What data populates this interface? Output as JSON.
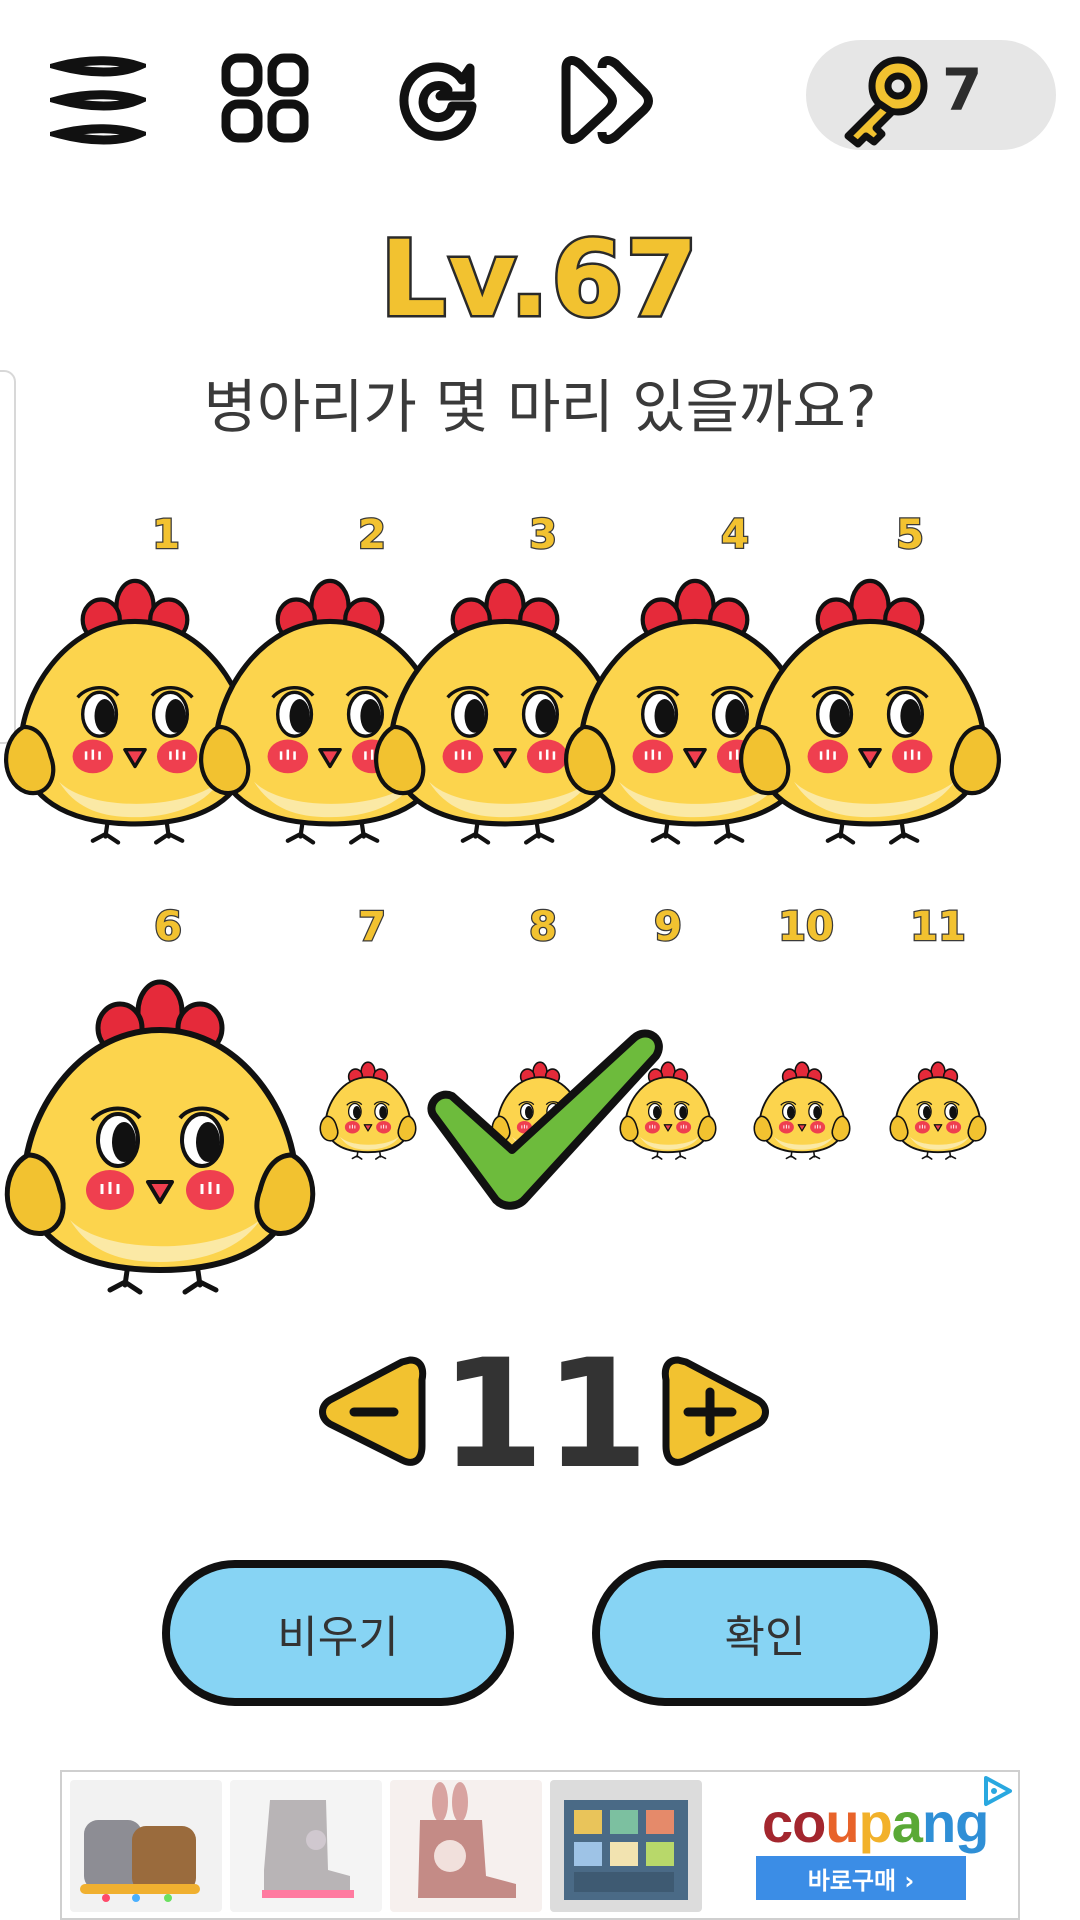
{
  "toolbar": {
    "icons": [
      "menu-icon",
      "grid-icon",
      "restart-icon",
      "skip-icon"
    ],
    "key_count": "7"
  },
  "level": {
    "title": "Lv.67"
  },
  "question": "병아리가 몇 마리 있을까요?",
  "chicks": {
    "labels": [
      "1",
      "2",
      "3",
      "4",
      "5",
      "6",
      "7",
      "8",
      "9",
      "10",
      "11"
    ]
  },
  "counter": {
    "value": "11",
    "minus_icon": "minus-arrow-icon",
    "plus_icon": "plus-arrow-icon"
  },
  "buttons": {
    "clear": "비우기",
    "confirm": "확인"
  },
  "ad": {
    "brand": "coupang",
    "cta": "바로구매 ›"
  },
  "colors": {
    "chick_body": "#fcd44d",
    "comb": "#e52a3a",
    "title_fill": "#f2c230",
    "button_fill": "#87d4f4",
    "check": "#6dbb3c"
  }
}
